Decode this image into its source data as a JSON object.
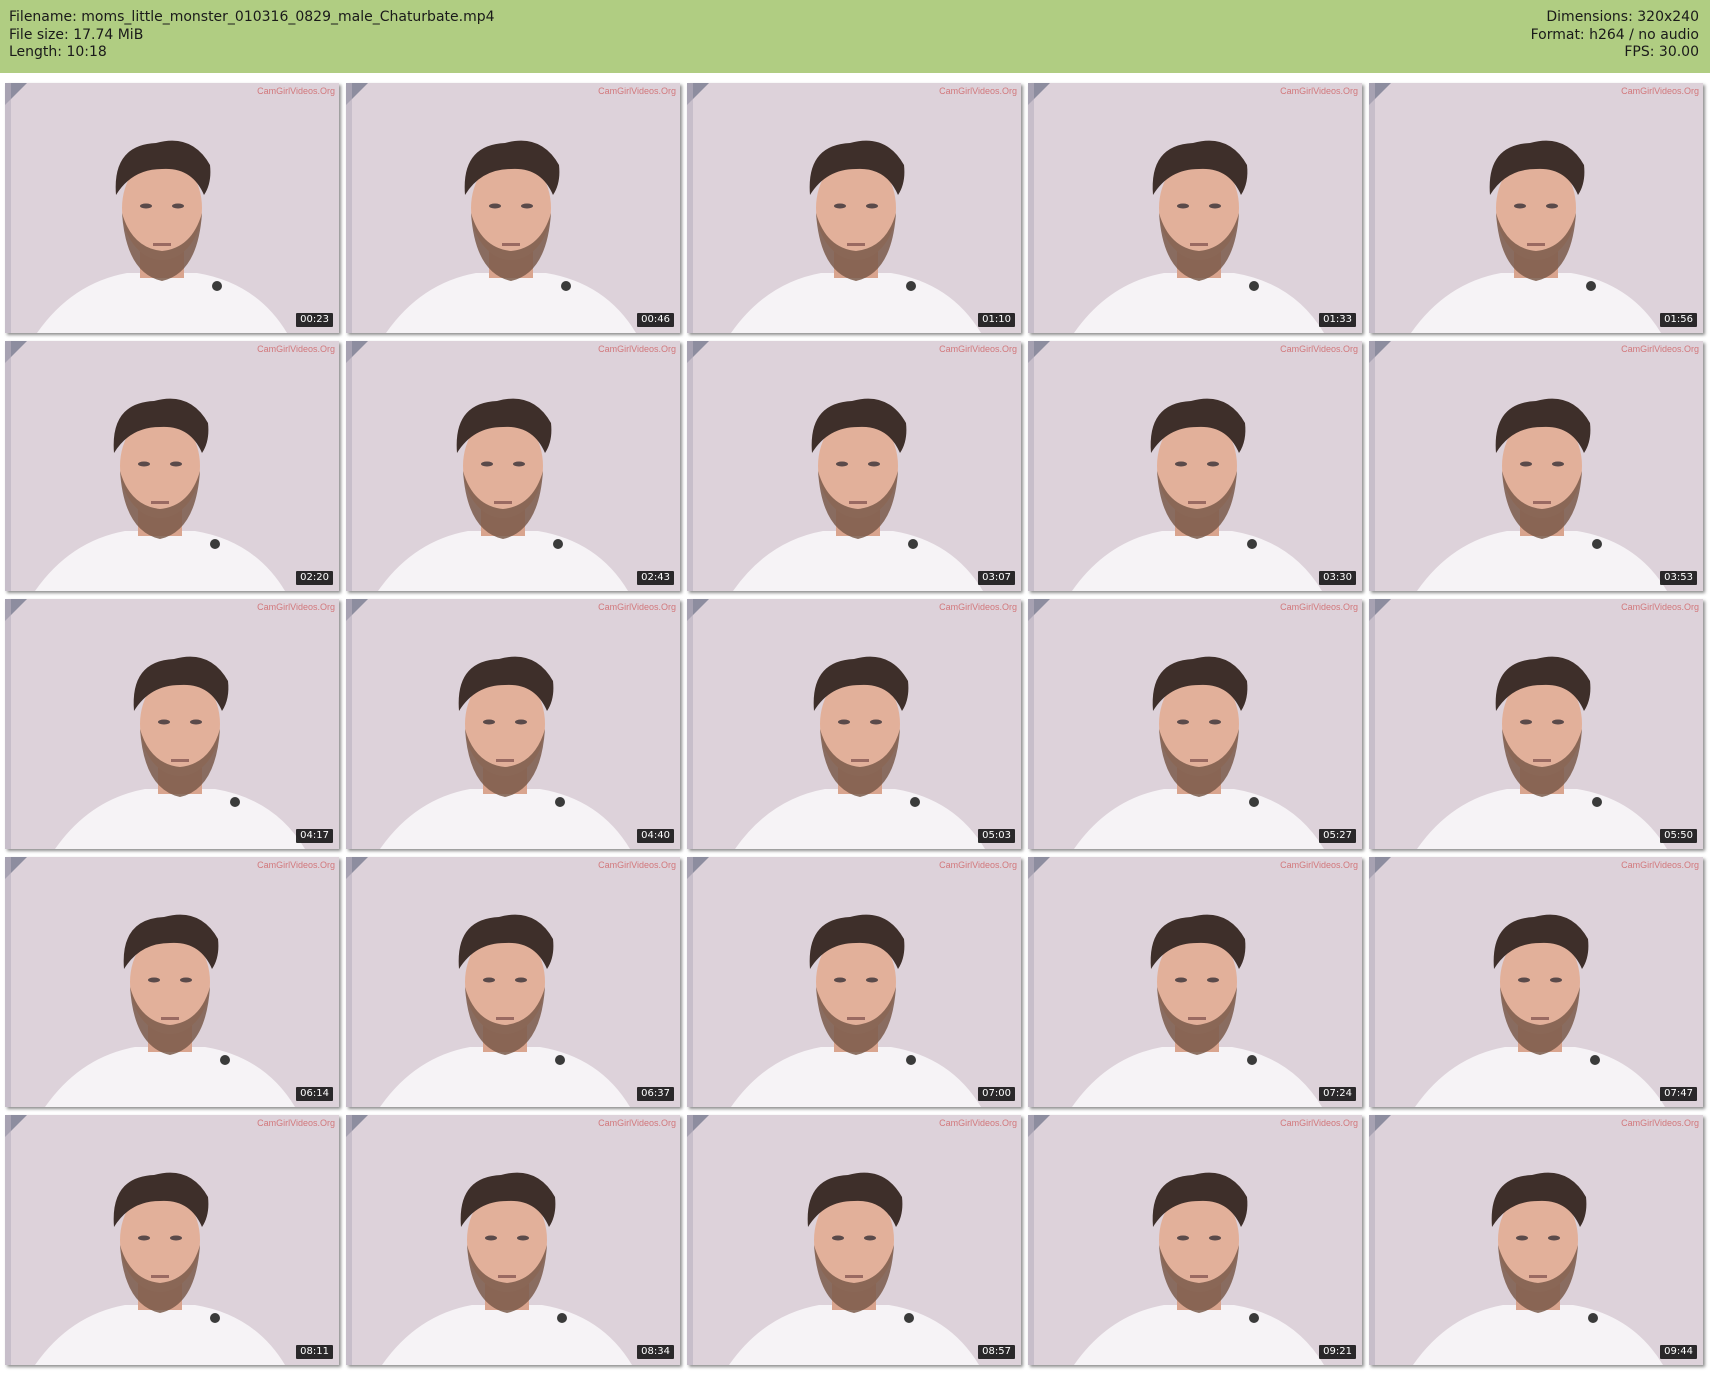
{
  "header": {
    "filename": "Filename: moms_little_monster_010316_0829_male_Chaturbate.mp4",
    "filesize": "File size: 17.74 MiB",
    "length": "Length: 10:18",
    "dimensions": "Dimensions: 320x240",
    "format": "Format: h264 / no audio",
    "fps": "FPS: 30.00"
  },
  "thumbnails": [
    {
      "time": "00:23",
      "watermark": "CamGirlVideos.Org"
    },
    {
      "time": "00:46",
      "watermark": "CamGirlVideos.Org"
    },
    {
      "time": "01:10",
      "watermark": "CamGirlVideos.Org"
    },
    {
      "time": "01:33",
      "watermark": "CamGirlVideos.Org"
    },
    {
      "time": "01:56",
      "watermark": "CamGirlVideos.Org"
    },
    {
      "time": "02:20",
      "watermark": "CamGirlVideos.Org"
    },
    {
      "time": "02:43",
      "watermark": "CamGirlVideos.Org"
    },
    {
      "time": "03:07",
      "watermark": "CamGirlVideos.Org"
    },
    {
      "time": "03:30",
      "watermark": "CamGirlVideos.Org"
    },
    {
      "time": "03:53",
      "watermark": "CamGirlVideos.Org"
    },
    {
      "time": "04:17",
      "watermark": "CamGirlVideos.Org"
    },
    {
      "time": "04:40",
      "watermark": "CamGirlVideos.Org"
    },
    {
      "time": "05:03",
      "watermark": "CamGirlVideos.Org"
    },
    {
      "time": "05:27",
      "watermark": "CamGirlVideos.Org"
    },
    {
      "time": "05:50",
      "watermark": "CamGirlVideos.Org"
    },
    {
      "time": "06:14",
      "watermark": "CamGirlVideos.Org"
    },
    {
      "time": "06:37",
      "watermark": "CamGirlVideos.Org"
    },
    {
      "time": "07:00",
      "watermark": "CamGirlVideos.Org"
    },
    {
      "time": "07:24",
      "watermark": "CamGirlVideos.Org"
    },
    {
      "time": "07:47",
      "watermark": "CamGirlVideos.Org"
    },
    {
      "time": "08:11",
      "watermark": "CamGirlVideos.Org"
    },
    {
      "time": "08:34",
      "watermark": "CamGirlVideos.Org"
    },
    {
      "time": "08:57",
      "watermark": "CamGirlVideos.Org"
    },
    {
      "time": "09:21",
      "watermark": "CamGirlVideos.Org"
    },
    {
      "time": "09:44",
      "watermark": "CamGirlVideos.Org"
    }
  ]
}
